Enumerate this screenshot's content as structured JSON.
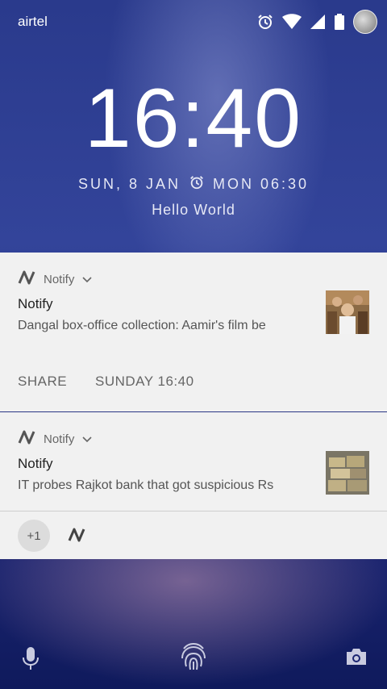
{
  "status_bar": {
    "carrier": "airtel",
    "icons": [
      "alarm-icon",
      "wifi-icon",
      "signal-icon",
      "battery-icon",
      "user-avatar"
    ]
  },
  "lockscreen": {
    "time": "16:40",
    "date": "SUN, 8 JAN",
    "alarm": "MON 06:30",
    "owner_message": "Hello World"
  },
  "notifications": [
    {
      "app_name": "Notify",
      "title": "Notify",
      "text": "Dangal box-office collection: Aamir's film be",
      "actions": [
        "SHARE",
        "SUNDAY 16:40"
      ]
    },
    {
      "app_name": "Notify",
      "title": "Notify",
      "text": "IT probes Rajkot bank that got suspicious Rs"
    }
  ],
  "overflow": {
    "count_label": "+1"
  },
  "bottom_shortcuts": [
    "mic-icon",
    "fingerprint-icon",
    "camera-icon"
  ]
}
